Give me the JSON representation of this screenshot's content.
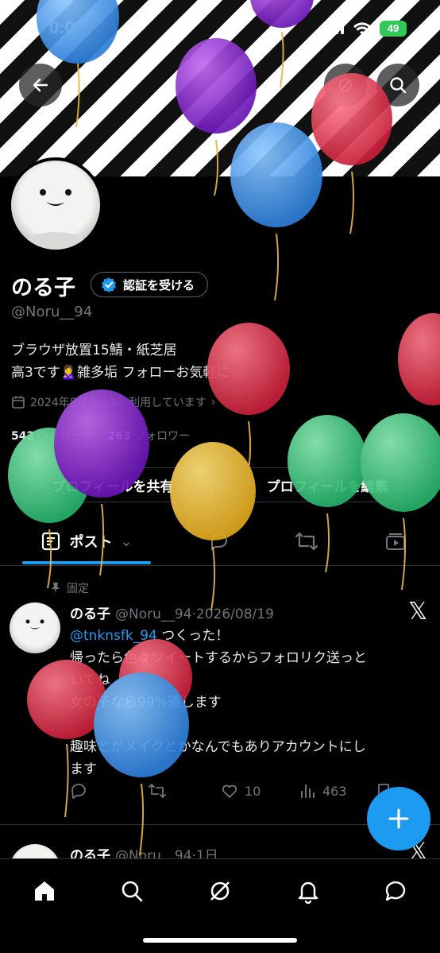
{
  "status_bar": {
    "time": "0:09",
    "battery": "49"
  },
  "profile": {
    "name": "のる子",
    "verify_label": "認証を受ける",
    "handle": "@Noru__94",
    "bio_line1": "ブラウザ放置15鯖・紙芝居",
    "bio_line2": "高3です🙎‍♀️雑多垢 フォローお気軽に",
    "joined": "2024年8月からXを利用しています",
    "following_count": "542",
    "following_label": "フォロー中",
    "followers_count": "263",
    "followers_label": "フォロワー",
    "share_button": "プロフィールを共有",
    "edit_button": "プロフィールを編集"
  },
  "tabs": {
    "posts_label": "ポスト"
  },
  "pinned_post": {
    "pinned_label": "固定",
    "author": "のる子",
    "meta": "@Noru__94·2026/08/19",
    "mention": "@tnknsfk_94",
    "line1_rest": " つくった！",
    "line2": "帰ったら色々ツイートするからフォロリク送っと",
    "line3": "いてね",
    "line4": "女の子なら99%通します",
    "line5": "趣味とかメイクとかなんでもありアカウントにし",
    "line6": "ます",
    "likes": "10",
    "views": "463"
  },
  "second_post": {
    "author": "のる子",
    "meta": "@Noru__94·1日"
  },
  "colors": {
    "accent": "#1d9bf0",
    "battery": "#34c759"
  },
  "icons": [
    "back-arrow-icon",
    "search-icon",
    "grok-icon",
    "verified-badge-icon",
    "calendar-icon",
    "pin-icon",
    "reply-icon",
    "repost-icon",
    "like-icon",
    "views-icon",
    "x-logo-icon",
    "plus-icon",
    "home-icon",
    "notifications-icon",
    "messages-icon"
  ]
}
